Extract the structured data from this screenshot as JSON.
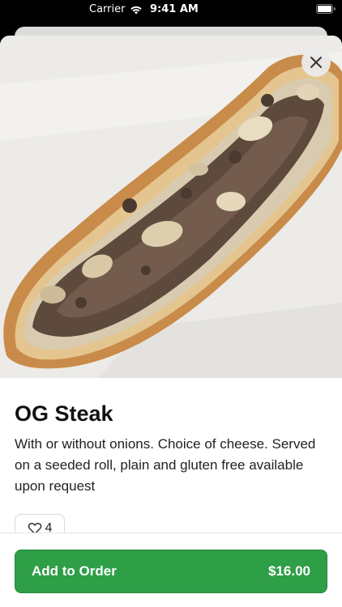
{
  "status_bar": {
    "carrier": "Carrier",
    "time": "9:41 AM"
  },
  "item": {
    "name": "OG Steak",
    "description": "With or without onions. Choice of cheese. Served on a seeded roll, plain and gluten free available upon request",
    "likes": "4",
    "image": "cheesesteak-photo"
  },
  "order": {
    "button_label": "Add to Order",
    "price": "$16.00"
  },
  "colors": {
    "accent": "#2e9e47",
    "text": "#111111"
  },
  "icons": [
    "wifi-icon",
    "battery-icon",
    "close-icon",
    "heart-icon"
  ]
}
